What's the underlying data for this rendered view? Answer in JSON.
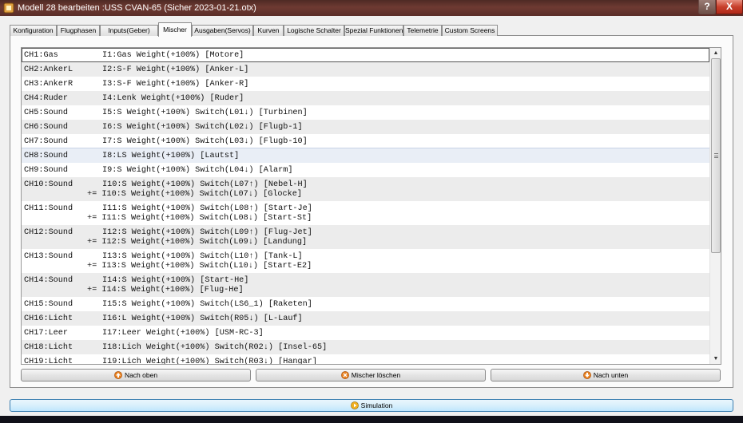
{
  "window": {
    "title": "Modell 28 bearbeiten :USS CVAN-65   (Sicher 2023-01-21.otx)",
    "help_label": "?",
    "close_label": "X"
  },
  "tabs": [
    {
      "label": "Konfiguration"
    },
    {
      "label": "Flugphasen"
    },
    {
      "label": "Inputs(Geber)"
    },
    {
      "label": "Mischer",
      "active": true
    },
    {
      "label": "Ausgaben(Servos)"
    },
    {
      "label": "Kurven"
    },
    {
      "label": "Logische Schalter"
    },
    {
      "label": "Spezial Funktionen"
    },
    {
      "label": "Telemetrie"
    },
    {
      "label": "Custom Screens"
    }
  ],
  "mixers": [
    {
      "channel": "CH1:Gas",
      "lines": [
        "I1:Gas Weight(+100%) [Motore]"
      ]
    },
    {
      "channel": "CH2:AnkerL",
      "lines": [
        "I2:S-F Weight(+100%) [Anker-L]"
      ]
    },
    {
      "channel": "CH3:AnkerR",
      "lines": [
        "I3:S-F Weight(+100%) [Anker-R]"
      ]
    },
    {
      "channel": "CH4:Ruder",
      "lines": [
        "I4:Lenk Weight(+100%) [Ruder]"
      ]
    },
    {
      "channel": "CH5:Sound",
      "lines": [
        "I5:S Weight(+100%) Switch(L01↓) [Turbinen]"
      ]
    },
    {
      "channel": "CH6:Sound",
      "lines": [
        "I6:S Weight(+100%) Switch(L02↓) [Flugb-1]"
      ]
    },
    {
      "channel": "CH7:Sound",
      "lines": [
        "I7:S Weight(+100%) Switch(L03↓) [Flugb-10]"
      ]
    },
    {
      "channel": "CH8:Sound",
      "lines": [
        "I8:LS Weight(+100%) [Lautst]"
      ]
    },
    {
      "channel": "CH9:Sound",
      "lines": [
        "I9:S Weight(+100%) Switch(L04↓) [Alarm]"
      ]
    },
    {
      "channel": "CH10:Sound",
      "lines": [
        "I10:S Weight(+100%) Switch(L07↑) [Nebel-H]",
        "+= I10:S Weight(+100%) Switch(L07↓) [Glocke]"
      ]
    },
    {
      "channel": "CH11:Sound",
      "lines": [
        "I11:S Weight(+100%) Switch(L08↑) [Start-Je]",
        "+= I11:S Weight(+100%) Switch(L08↓) [Start-St]"
      ]
    },
    {
      "channel": "CH12:Sound",
      "lines": [
        "I12:S Weight(+100%) Switch(L09↑) [Flug-Jet]",
        "+= I12:S Weight(+100%) Switch(L09↓) [Landung]"
      ]
    },
    {
      "channel": "CH13:Sound",
      "lines": [
        "I13:S Weight(+100%) Switch(L10↑) [Tank-L]",
        "+= I13:S Weight(+100%) Switch(L10↓) [Start-E2]"
      ]
    },
    {
      "channel": "CH14:Sound",
      "lines": [
        "I14:S Weight(+100%) [Start-He]",
        "+= I14:S Weight(+100%) [Flug-He]"
      ]
    },
    {
      "channel": "CH15:Sound",
      "lines": [
        "I15:S Weight(+100%) Switch(LS6_1) [Raketen]"
      ]
    },
    {
      "channel": "CH16:Licht",
      "lines": [
        "I16:L Weight(+100%) Switch(R05↓) [L-Lauf]"
      ]
    },
    {
      "channel": "CH17:Leer",
      "lines": [
        "I17:Leer Weight(+100%) [USM-RC-3]"
      ]
    },
    {
      "channel": "CH18:Licht",
      "lines": [
        "I18:Lich Weight(+100%) Switch(R02↓) [Insel-65]"
      ]
    },
    {
      "channel": "CH19:Licht",
      "lines": [
        "I19:Lich Weight(+100%) Switch(R03↓) [Hangar]"
      ]
    }
  ],
  "scrollbar": {
    "up_glyph": "▲",
    "down_glyph": "▼"
  },
  "buttons": {
    "move_up": "Nach oben",
    "delete": "Mischer löschen",
    "move_down": "Nach unten",
    "simulation": "Simulation"
  },
  "icons": {
    "move_up": "arrow-up-icon",
    "delete": "delete-icon",
    "move_down": "arrow-down-icon",
    "simulation": "play-icon",
    "app": "app-icon"
  },
  "colors": {
    "titlebar": "#5a2d28",
    "close": "#c8402c",
    "icon_orange": "#e8801e",
    "simulation_border": "#3c7fb1"
  }
}
